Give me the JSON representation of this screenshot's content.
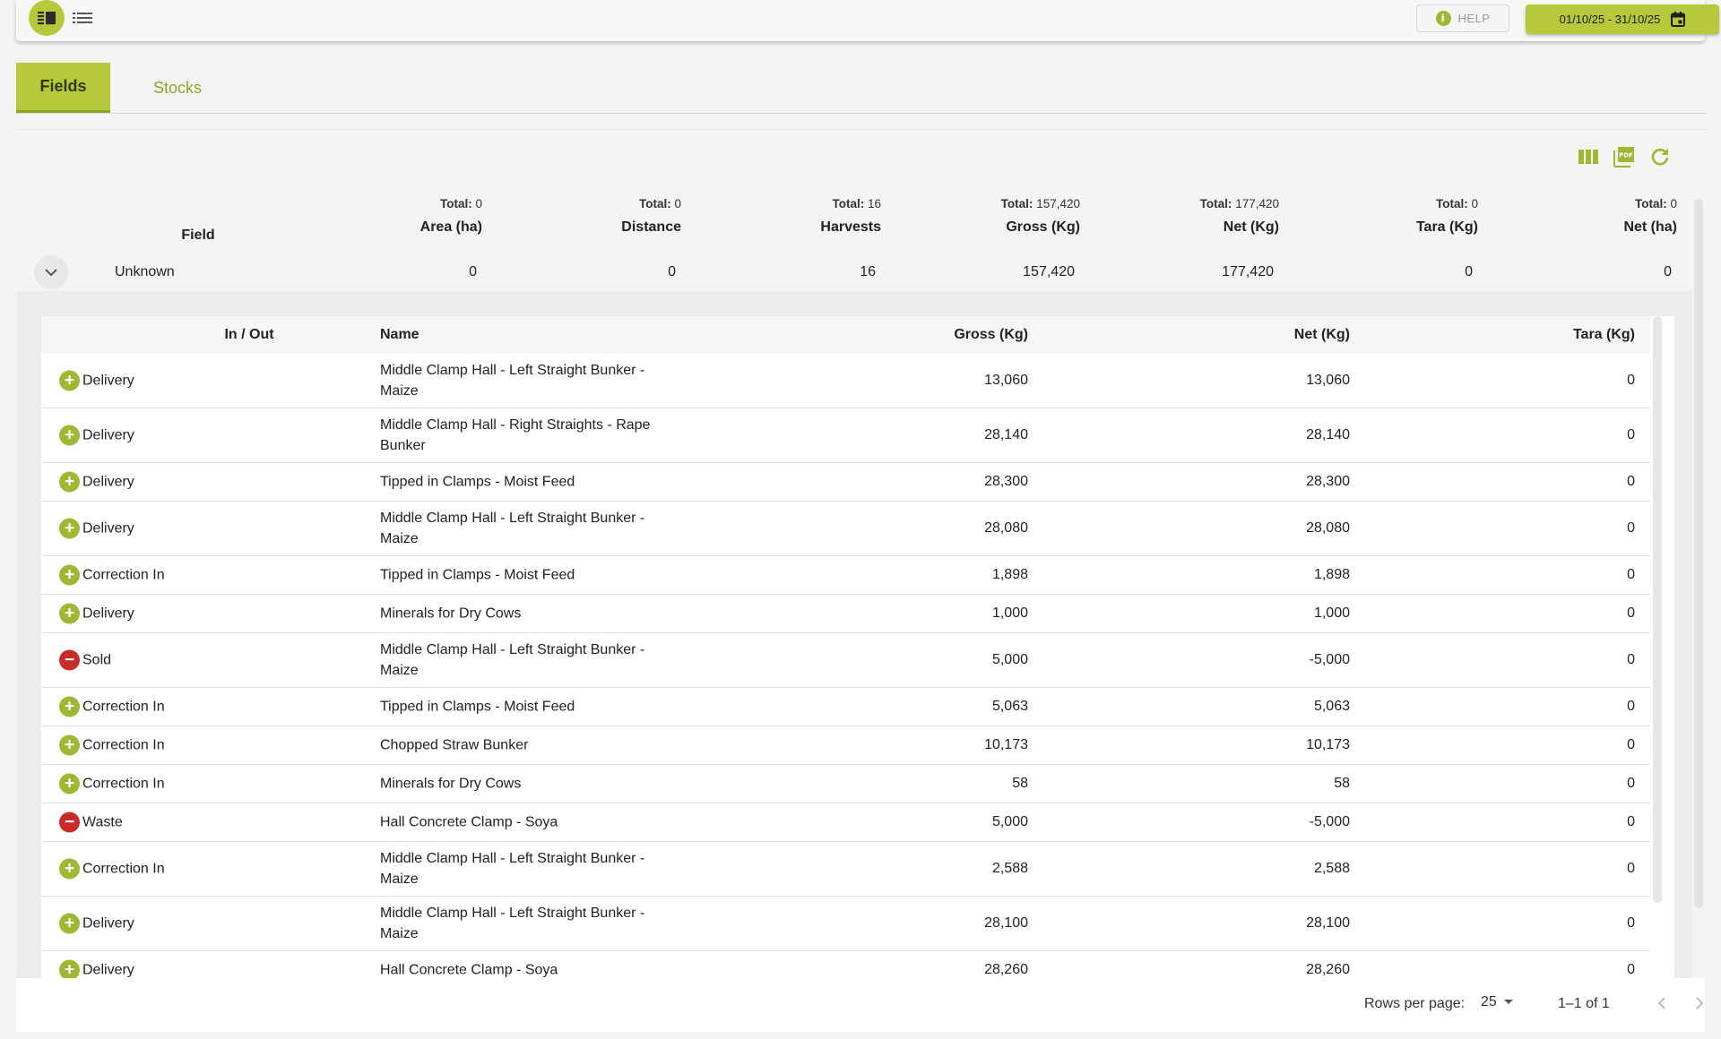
{
  "topbar": {
    "menu_icon": "sidebar-toggle-icon",
    "list_icon": "list-icon",
    "help_label": "HELP",
    "date_range": "01/10/25 - 31/10/25"
  },
  "tabs": [
    {
      "label": "Fields",
      "active": true
    },
    {
      "label": "Stocks",
      "active": false
    }
  ],
  "toolbar": {
    "icons": [
      "columns-icon",
      "pdf-icon",
      "refresh-icon"
    ]
  },
  "summary": {
    "field_header": "Field",
    "columns": [
      {
        "total_label": "Total:",
        "total_value": "0",
        "header": "Area (ha)",
        "value": "0"
      },
      {
        "total_label": "Total:",
        "total_value": "0",
        "header": "Distance",
        "value": "0"
      },
      {
        "total_label": "Total:",
        "total_value": "16",
        "header": "Harvests",
        "value": "16"
      },
      {
        "total_label": "Total:",
        "total_value": "157,420",
        "header": "Gross (Kg)",
        "value": "157,420"
      },
      {
        "total_label": "Total:",
        "total_value": "177,420",
        "header": "Net (Kg)",
        "value": "177,420"
      },
      {
        "total_label": "Total:",
        "total_value": "0",
        "header": "Tara (Kg)",
        "value": "0"
      },
      {
        "total_label": "Total:",
        "total_value": "0",
        "header": "Net (ha)",
        "value": "0"
      }
    ],
    "group_name": "Unknown"
  },
  "detail": {
    "headers": {
      "io": "In / Out",
      "name": "Name",
      "gross": "Gross (Kg)",
      "net": "Net (Kg)",
      "tara": "Tara (Kg)"
    },
    "rows": [
      {
        "type": "in",
        "io": "Delivery",
        "name": "Middle Clamp Hall - Left Straight Bunker - Maize",
        "gross": "13,060",
        "net": "13,060",
        "tara": "0"
      },
      {
        "type": "in",
        "io": "Delivery",
        "name": "Middle Clamp Hall - Right Straights - Rape Bunker",
        "gross": "28,140",
        "net": "28,140",
        "tara": "0"
      },
      {
        "type": "in",
        "io": "Delivery",
        "name": "Tipped in Clamps - Moist Feed",
        "gross": "28,300",
        "net": "28,300",
        "tara": "0"
      },
      {
        "type": "in",
        "io": "Delivery",
        "name": "Middle Clamp Hall - Left Straight Bunker - Maize",
        "gross": "28,080",
        "net": "28,080",
        "tara": "0"
      },
      {
        "type": "in",
        "io": "Correction In",
        "name": "Tipped in Clamps - Moist Feed",
        "gross": "1,898",
        "net": "1,898",
        "tara": "0"
      },
      {
        "type": "in",
        "io": "Delivery",
        "name": "Minerals for Dry Cows",
        "gross": "1,000",
        "net": "1,000",
        "tara": "0"
      },
      {
        "type": "out",
        "io": "Sold",
        "name": "Middle Clamp Hall - Left Straight Bunker - Maize",
        "gross": "5,000",
        "net": "-5,000",
        "tara": "0"
      },
      {
        "type": "in",
        "io": "Correction In",
        "name": "Tipped in Clamps - Moist Feed",
        "gross": "5,063",
        "net": "5,063",
        "tara": "0"
      },
      {
        "type": "in",
        "io": "Correction In",
        "name": "Chopped Straw Bunker",
        "gross": "10,173",
        "net": "10,173",
        "tara": "0"
      },
      {
        "type": "in",
        "io": "Correction In",
        "name": "Minerals for Dry Cows",
        "gross": "58",
        "net": "58",
        "tara": "0"
      },
      {
        "type": "out",
        "io": "Waste",
        "name": "Hall Concrete Clamp - Soya",
        "gross": "5,000",
        "net": "-5,000",
        "tara": "0"
      },
      {
        "type": "in",
        "io": "Correction In",
        "name": "Middle Clamp Hall - Left Straight Bunker - Maize",
        "gross": "2,588",
        "net": "2,588",
        "tara": "0"
      },
      {
        "type": "in",
        "io": "Delivery",
        "name": "Middle Clamp Hall - Left Straight Bunker - Maize",
        "gross": "28,100",
        "net": "28,100",
        "tara": "0"
      },
      {
        "type": "in",
        "io": "Delivery",
        "name": "Hall Concrete Clamp - Soya",
        "gross": "28,260",
        "net": "28,260",
        "tara": "0"
      }
    ]
  },
  "footer": {
    "rows_per_page_label": "Rows per page:",
    "rows_per_page": "25",
    "range": "1–1 of 1"
  },
  "colors": {
    "accent": "#b5c93a",
    "in": "#9eb834",
    "out": "#c92a2a"
  }
}
